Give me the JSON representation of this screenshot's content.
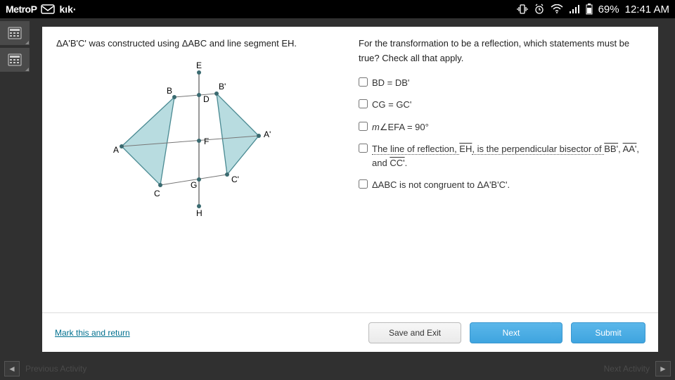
{
  "status": {
    "carrier": "MetroP",
    "app": "kık·",
    "battery": "69%",
    "time": "12:41 AM"
  },
  "question": {
    "left_prompt": "ΔA'B'C' was constructed using ΔABC and line segment EH.",
    "right_prompt": "For the transformation to be a reflection, which statements must be true? Check all that apply.",
    "options": {
      "o1": "BD = DB'",
      "o2": "CG = GC'",
      "o3_pre": "m",
      "o3_post": "EFA = 90°",
      "o4_a": "The line of reflection, ",
      "o4_eh": "EH",
      "o4_b": ", is the perpendicular bisector of ",
      "o4_seg1": "BB'",
      "o4_c": ", ",
      "o4_seg2": "AA'",
      "o4_d": ", and ",
      "o4_seg3": "CC'",
      "o4_e": ".",
      "o5": "ΔABC is not congruent to ΔA'B'C'."
    },
    "labels": {
      "A": "A",
      "B": "B",
      "C": "C",
      "Ap": "A'",
      "Bp": "B'",
      "Cp": "C'",
      "D": "D",
      "E": "E",
      "F": "F",
      "G": "G",
      "H": "H"
    }
  },
  "footer": {
    "mark": "Mark this and return",
    "save": "Save and Exit",
    "next": "Next",
    "submit": "Submit"
  },
  "nav": {
    "prev": "Previous Activity",
    "next": "Next Activity"
  }
}
